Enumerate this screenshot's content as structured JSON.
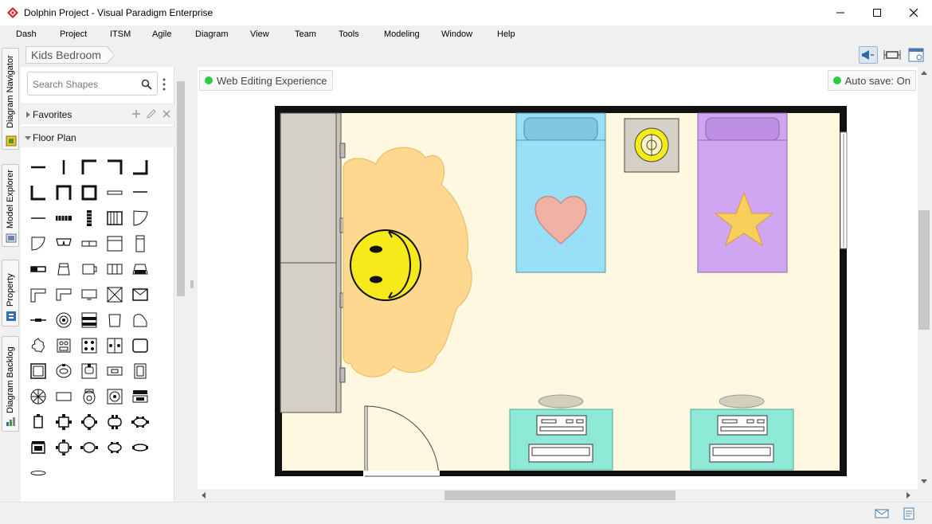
{
  "window": {
    "title": "Dolphin Project - Visual Paradigm Enterprise"
  },
  "menu": [
    "Dash",
    "Project",
    "ITSM",
    "Agile",
    "Diagram",
    "View",
    "Team",
    "Tools",
    "Modeling",
    "Window",
    "Help"
  ],
  "side_tabs": [
    "Diagram Navigator",
    "Model Explorer",
    "Property",
    "Diagram Backlog"
  ],
  "breadcrumb": {
    "label": "Kids Bedroom"
  },
  "shapes": {
    "search_placeholder": "Search Shapes",
    "favorites_label": "Favorites",
    "floor_plan_label": "Floor Plan"
  },
  "canvas": {
    "web_editing": "Web Editing Experience",
    "auto_save": "Auto save: On"
  },
  "colors": {
    "floor": "#fff8e1",
    "wall": "#111111",
    "rug": "#fdd88e",
    "smiley": "#f7ea1a",
    "bed_blue": "#99dff5",
    "bed_purple": "#d0a5f2",
    "desk": "#8ee8d6",
    "wardrobe": "#d4d0c5",
    "status_green": "#2ecc40"
  },
  "icons": [
    "app-logo-icon",
    "minimize-icon",
    "maximize-icon",
    "close-icon",
    "search-icon",
    "kebab-icon",
    "add-icon",
    "edit-icon",
    "remove-icon",
    "announce-icon",
    "fit-icon",
    "layout-icon",
    "mail-icon",
    "document-icon"
  ]
}
